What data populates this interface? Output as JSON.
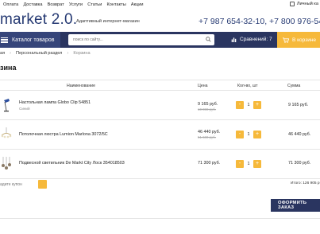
{
  "topnav": {
    "links": [
      "Оплата",
      "Доставка",
      "Возврат",
      "Услуги",
      "Статьи",
      "Контакты",
      "Акции"
    ],
    "account_label": "Личный ка"
  },
  "brand": {
    "logo": "market 2.0.",
    "tagline": "Адаптивный интернет-магазин",
    "phones": "+7 987 654-32-10, +7 800 976-54"
  },
  "navbar": {
    "catalog_label": "Каталог товаров",
    "search_placeholder": "поиск по сайту...",
    "compare_label": "Сравнений: 7",
    "cart_label": "В корзине"
  },
  "breadcrumbs": {
    "items": [
      "ая",
      "Персональный раздел",
      "Корзина"
    ]
  },
  "page": {
    "title": "зина"
  },
  "table": {
    "headers": {
      "name": "Наименование",
      "price": "Цена",
      "qty": "Кол-во, шт",
      "sum": "Сумма"
    },
    "rows": [
      {
        "name": "Настольная лампа Globo Clip 54851",
        "sub": "Синий",
        "price": "9 165 руб.",
        "old_price": "10 000 руб.",
        "qty": "1",
        "sum": "9 165 руб."
      },
      {
        "name": "Потолочная люстра Lumion Marlona 3072/5C",
        "sub": "",
        "price": "46 440 руб.",
        "old_price": "51 600 руб.",
        "qty": "1",
        "sum": "46 440 руб."
      },
      {
        "name": "Подвесной светильник De Markt City Лоск 354018503",
        "sub": "",
        "price": "71 300 руб.",
        "old_price": "",
        "qty": "1",
        "sum": "71 300 руб."
      }
    ]
  },
  "footer": {
    "coupon_placeholder": "адите купон",
    "total_label": "Итого:",
    "total_value": "126 905 р",
    "checkout_label": "ОФОРМИТЬ ЗАКАЗ"
  },
  "colors": {
    "brand": "#263a73",
    "nav": "#2a3560",
    "accent": "#f6b93b"
  }
}
